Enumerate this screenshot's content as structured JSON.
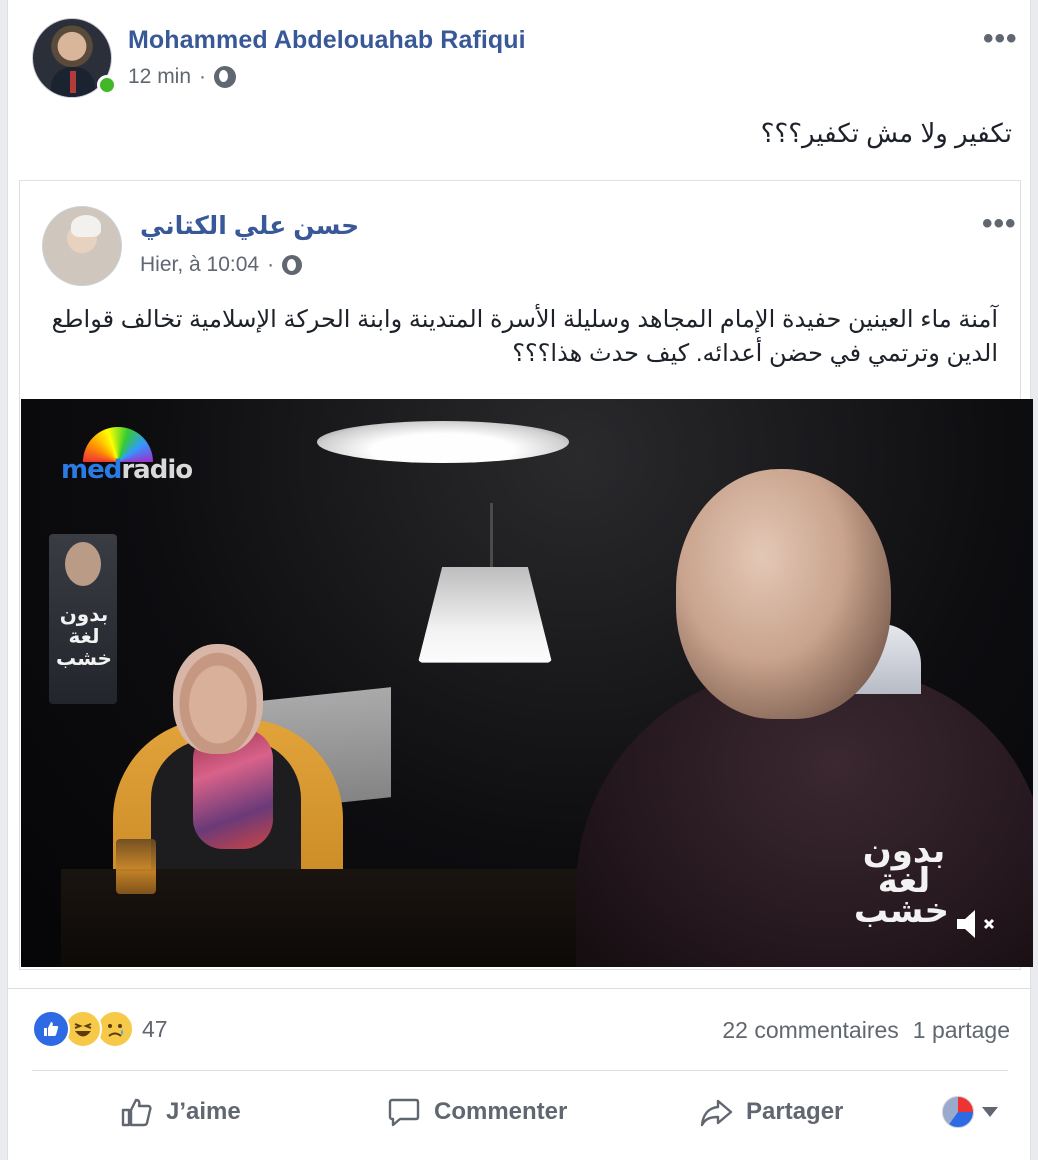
{
  "post": {
    "author": "Mohammed Abdelouahab Rafiqui",
    "time": "12 min",
    "separator": "·",
    "privacy_icon": "globe-icon",
    "text": "تكفير ولا مش تكفير؟؟؟",
    "more_icon": "more-options-icon",
    "more_label": "•••"
  },
  "shared": {
    "author": "حسن علي الكتاني",
    "time": "Hier, à 10:04",
    "separator": "·",
    "privacy_icon": "globe-icon",
    "more_label": "•••",
    "text": "آمنة ماء العينين حفيدة الإمام المجاهد وسليلة الأسرة المتدينة وابنة الحركة الإسلامية تخالف قواطع الدين وترتمي في حضن أعدائه. كيف حدث هذا؟؟؟",
    "video": {
      "logo_med": "med",
      "logo_radio": "radio",
      "poster_text": "بدون لغة خشب",
      "watermark": "بدون لغة خشب",
      "mute_icon": "speaker-muted-icon"
    }
  },
  "reactions": {
    "icons": [
      "like-reaction-icon",
      "haha-reaction-icon",
      "sad-reaction-icon"
    ],
    "count": "47",
    "comments": "22 commentaires",
    "shares": "1 partage"
  },
  "actions": {
    "like": "J’aime",
    "comment": "Commenter",
    "share": "Partager"
  },
  "colors": {
    "link": "#385898",
    "secondary": "#606770",
    "online": "#42b72a",
    "like_blue": "#2e6ae4"
  }
}
